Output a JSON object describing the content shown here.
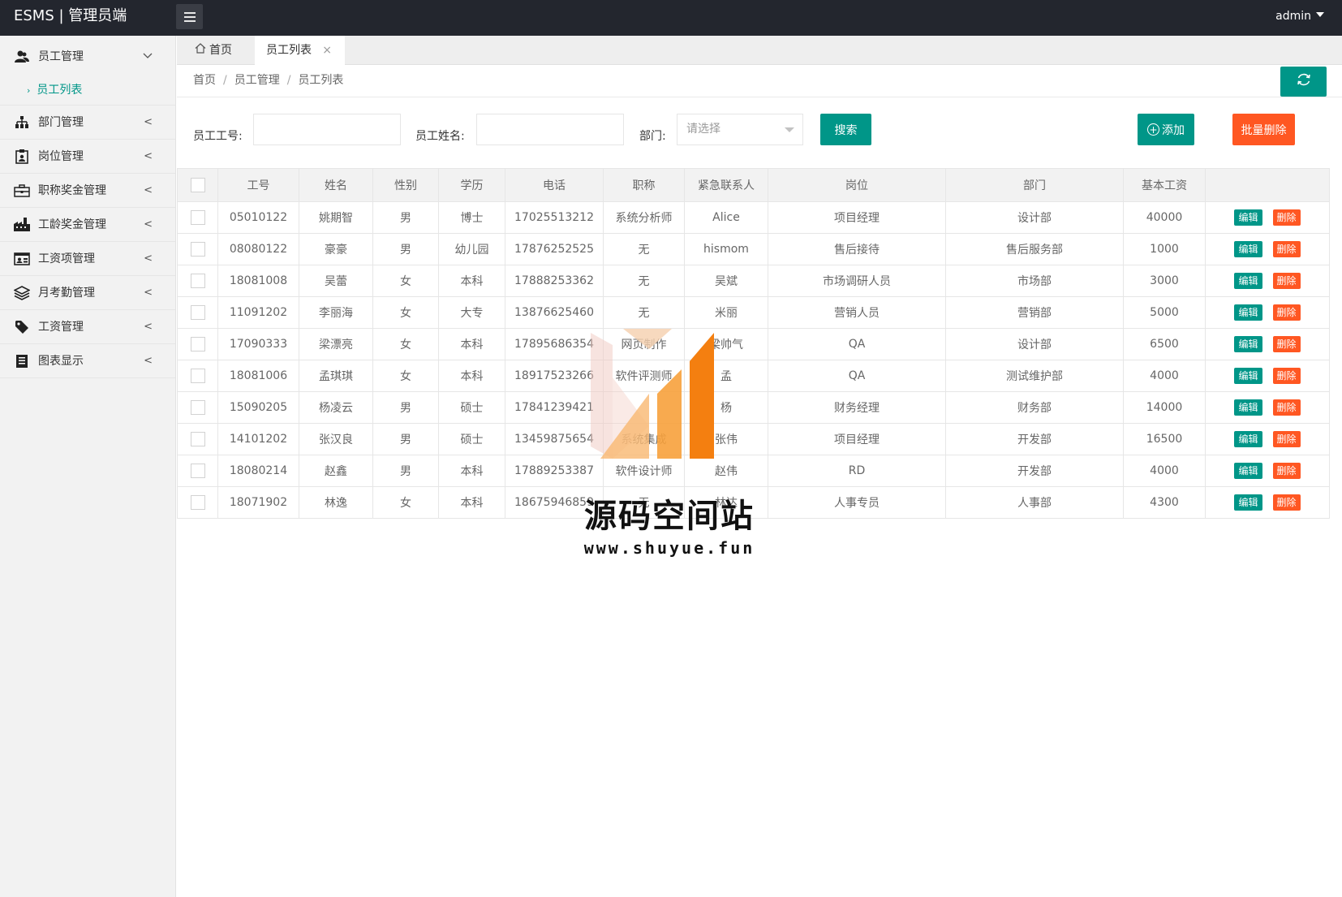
{
  "app": {
    "brand": "ESMS | 管理员端",
    "user": "admin"
  },
  "sidebar": {
    "groups": [
      {
        "label": "员工管理",
        "icon": "user-group-icon",
        "children": [
          {
            "label": "员工列表"
          }
        ]
      },
      {
        "label": "部门管理",
        "icon": "sitemap-icon"
      },
      {
        "label": "岗位管理",
        "icon": "badge-icon"
      },
      {
        "label": "职称奖金管理",
        "icon": "briefcase-icon"
      },
      {
        "label": "工龄奖金管理",
        "icon": "factory-icon"
      },
      {
        "label": "工资项管理",
        "icon": "id-card-icon"
      },
      {
        "label": "月考勤管理",
        "icon": "layers-icon"
      },
      {
        "label": "工资管理",
        "icon": "tag-icon"
      },
      {
        "label": "图表显示",
        "icon": "document-icon"
      }
    ]
  },
  "tabs": {
    "home": "首页",
    "active": "员工列表"
  },
  "breadcrumb": [
    "首页",
    "员工管理",
    "员工列表"
  ],
  "search": {
    "id_label": "员工工号:",
    "name_label": "员工姓名:",
    "dept_label": "部门:",
    "dept_placeholder": "请选择",
    "search_button": "搜索",
    "add_button": "添加",
    "batch_delete_button": "批量删除"
  },
  "table": {
    "columns": [
      "工号",
      "姓名",
      "性别",
      "学历",
      "电话",
      "职称",
      "紧急联系人",
      "岗位",
      "部门",
      "基本工资"
    ],
    "edit_label": "编辑",
    "delete_label": "删除",
    "rows": [
      [
        "05010122",
        "姚期智",
        "男",
        "博士",
        "17025513212",
        "系统分析师",
        "Alice",
        "项目经理",
        "设计部",
        "40000"
      ],
      [
        "08080122",
        "豪豪",
        "男",
        "幼儿园",
        "17876252525",
        "无",
        "hismom",
        "售后接待",
        "售后服务部",
        "1000"
      ],
      [
        "18081008",
        "吴蕾",
        "女",
        "本科",
        "17888253362",
        "无",
        "吴斌",
        "市场调研人员",
        "市场部",
        "3000"
      ],
      [
        "11091202",
        "李丽海",
        "女",
        "大专",
        "13876625460",
        "无",
        "米丽",
        "营销人员",
        "营销部",
        "5000"
      ],
      [
        "17090333",
        "梁漂亮",
        "女",
        "本科",
        "17895686354",
        "网页制作",
        "梁帅气",
        "QA",
        "设计部",
        "6500"
      ],
      [
        "18081006",
        "孟琪琪",
        "女",
        "本科",
        "18917523266",
        "软件评测师",
        "孟",
        "QA",
        "测试维护部",
        "4000"
      ],
      [
        "15090205",
        "杨凌云",
        "男",
        "硕士",
        "17841239421",
        "",
        "杨",
        "财务经理",
        "财务部",
        "14000"
      ],
      [
        "14101202",
        "张汉良",
        "男",
        "硕士",
        "13459875654",
        "系统集成",
        "张伟",
        "项目经理",
        "开发部",
        "16500"
      ],
      [
        "18080214",
        "赵鑫",
        "男",
        "本科",
        "17889253387",
        "软件设计师",
        "赵伟",
        "RD",
        "开发部",
        "4000"
      ],
      [
        "18071902",
        "林逸",
        "女",
        "本科",
        "18675946859",
        "无",
        "林达",
        "人事专员",
        "人事部",
        "4300"
      ]
    ]
  },
  "watermark": {
    "title": "源码空间站",
    "url": "www.shuyue.fun"
  },
  "colors": {
    "primary": "#009688",
    "danger": "#ff5722",
    "topbar": "#23262e"
  }
}
